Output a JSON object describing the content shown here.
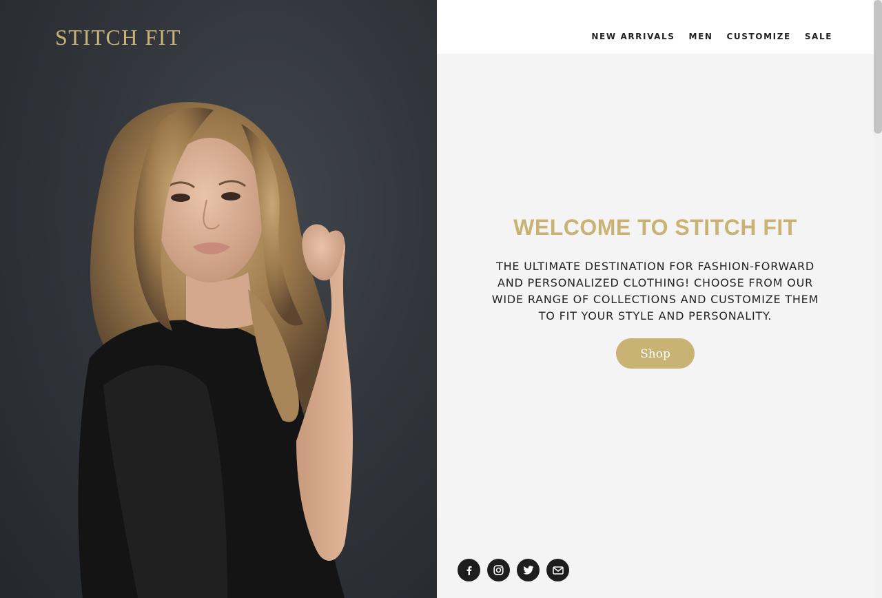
{
  "brand": {
    "logo_text": "STITCH FIT"
  },
  "nav": {
    "items": [
      {
        "label": "NEW ARRIVALS"
      },
      {
        "label": "MEN"
      },
      {
        "label": "CUSTOMIZE"
      },
      {
        "label": "SALE"
      }
    ]
  },
  "hero": {
    "heading": "WELCOME TO STITCH FIT",
    "description": "THE ULTIMATE DESTINATION FOR FASHION-FORWARD AND PERSONALIZED CLOTHING! CHOOSE FROM OUR WIDE RANGE OF COLLECTIONS AND CUSTOMIZE THEM TO FIT YOUR STYLE AND PERSONALITY.",
    "cta_label": "Shop"
  },
  "social": {
    "icons": [
      "facebook-icon",
      "instagram-icon",
      "twitter-icon",
      "email-icon"
    ]
  },
  "colors": {
    "accent": "#c8b274",
    "dark": "#1e1e1e",
    "panel_bg": "#f4f4f4",
    "hero_bg": "#33373d"
  }
}
